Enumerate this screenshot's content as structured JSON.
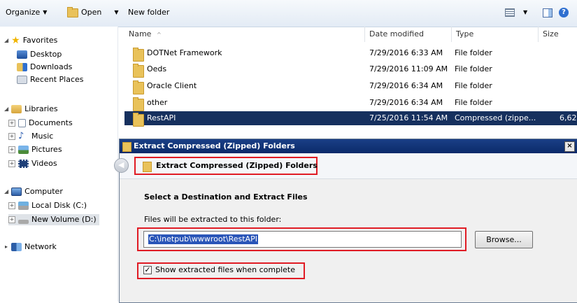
{
  "toolbar": {
    "organize_label": "Organize",
    "open_label": "Open",
    "new_folder_label": "New folder"
  },
  "nav": {
    "favorites": {
      "label": "Favorites",
      "items": [
        {
          "label": "Desktop"
        },
        {
          "label": "Downloads"
        },
        {
          "label": "Recent Places"
        }
      ]
    },
    "libraries": {
      "label": "Libraries",
      "items": [
        {
          "label": "Documents"
        },
        {
          "label": "Music"
        },
        {
          "label": "Pictures"
        },
        {
          "label": "Videos"
        }
      ]
    },
    "computer": {
      "label": "Computer",
      "items": [
        {
          "label": "Local Disk (C:)"
        },
        {
          "label": "New Volume (D:)"
        }
      ]
    },
    "network": {
      "label": "Network"
    }
  },
  "file_list": {
    "columns": {
      "name": "Name",
      "date": "Date modified",
      "type": "Type",
      "size": "Size"
    },
    "rows": [
      {
        "name": "DOTNet Framework",
        "date": "7/29/2016 6:33 AM",
        "type": "File folder",
        "size": ""
      },
      {
        "name": "Oeds",
        "date": "7/29/2016 11:09 AM",
        "type": "File folder",
        "size": ""
      },
      {
        "name": "Oracle Client",
        "date": "7/29/2016 6:34 AM",
        "type": "File folder",
        "size": ""
      },
      {
        "name": "other",
        "date": "7/29/2016 6:34 AM",
        "type": "File folder",
        "size": ""
      },
      {
        "name": "RestAPI",
        "date": "7/25/2016 11:54 AM",
        "type": "Compressed (zippe...",
        "size": "6,62"
      }
    ]
  },
  "dialog": {
    "window_title": "Extract Compressed (Zipped) Folders",
    "header_title": "Extract Compressed (Zipped) Folders",
    "section_title": "Select a Destination and Extract Files",
    "path_label": "Files will be extracted to this folder:",
    "path_value": "C:\\inetpub\\wwwroot\\RestAPI",
    "browse_label": "Browse...",
    "show_files_label": "Show extracted files when complete",
    "show_files_checked": true
  },
  "colors": {
    "selection": "#16305e",
    "highlight_box": "#e01b24",
    "titlebar": "#0b2a6a"
  }
}
